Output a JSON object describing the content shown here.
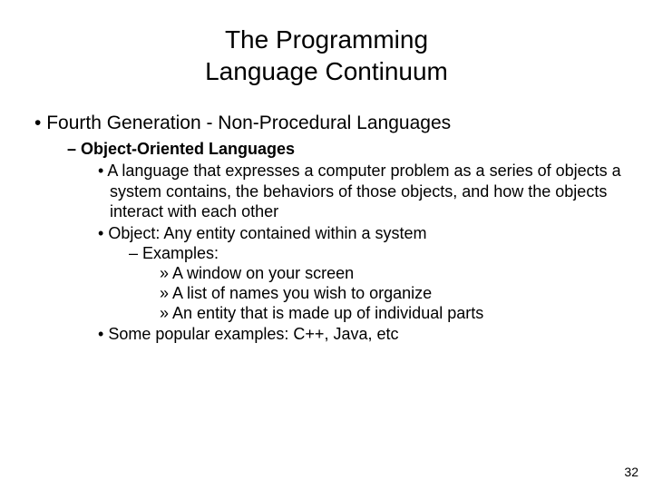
{
  "title_line1": "The Programming",
  "title_line2": "Language Continuum",
  "level1_text": "Fourth Generation - Non-Procedural Languages",
  "level2_text": "Object-Oriented Languages",
  "level3_item1": "A language that expresses a computer problem as a series of objects a system contains, the behaviors of those objects, and how the objects interact with each other",
  "level3_item2": "Object: Any entity contained within a system",
  "level4_item1": "Examples:",
  "level5_item1": "A window on your screen",
  "level5_item2": "A list of names you wish to organize",
  "level5_item3": "An entity that is made up of individual parts",
  "level3_item3": "Some popular examples: C++, Java, etc",
  "page_number": "32"
}
